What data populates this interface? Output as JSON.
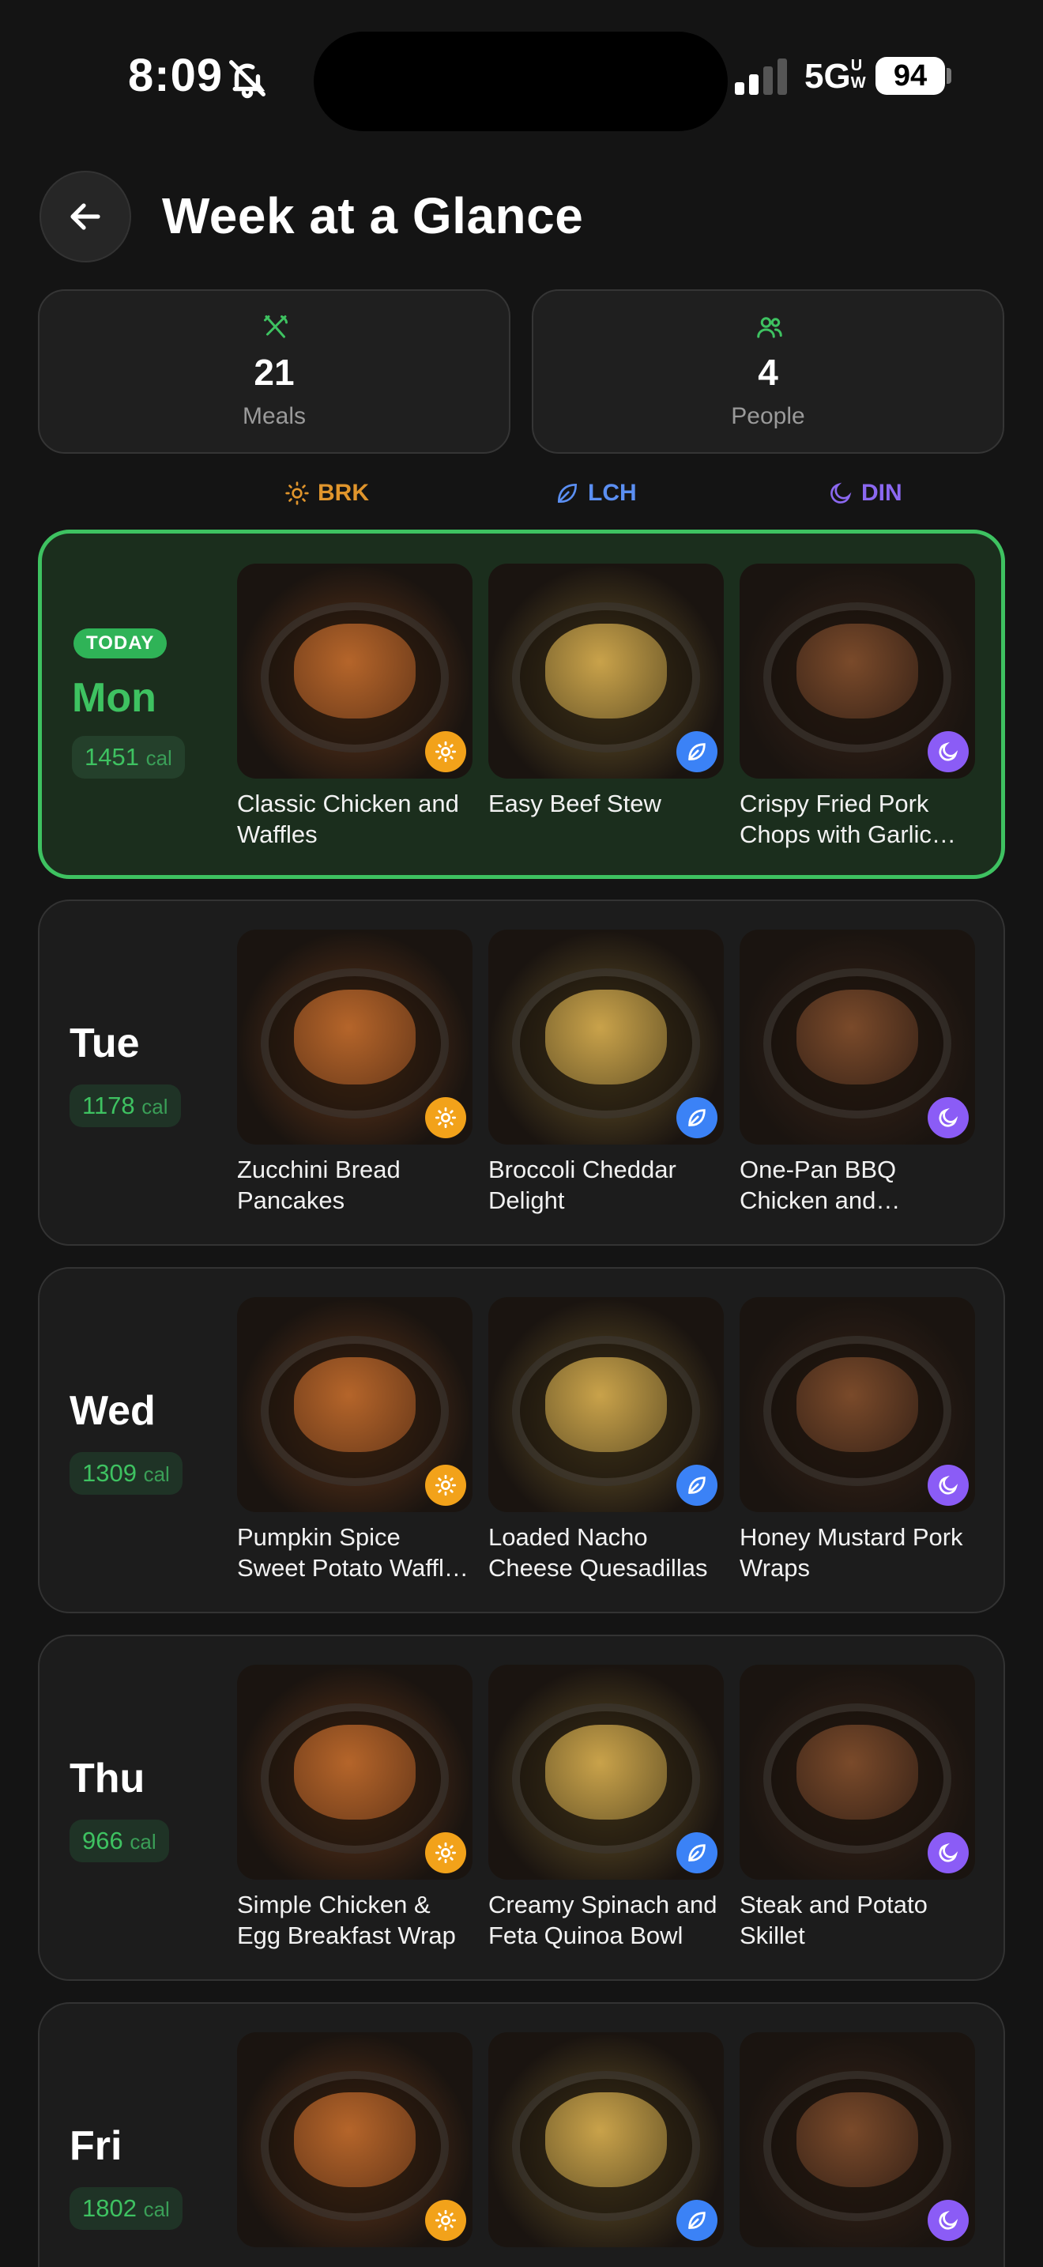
{
  "status_bar": {
    "time": "8:09",
    "network": "5G",
    "network_sup": "UW",
    "battery": "94"
  },
  "header": {
    "title": "Week at a Glance",
    "back_icon": "arrow-left-icon"
  },
  "stats": {
    "meals": {
      "value": "21",
      "label": "Meals",
      "icon": "utensils-icon"
    },
    "people": {
      "value": "4",
      "label": "People",
      "icon": "people-icon"
    }
  },
  "legend": {
    "breakfast": {
      "label": "BRK",
      "icon": "sun-icon",
      "color": "#e0952c"
    },
    "lunch": {
      "label": "LCH",
      "icon": "leaf-icon",
      "color": "#5b8ff2"
    },
    "dinner": {
      "label": "DIN",
      "icon": "moon-icon",
      "color": "#8b68f0"
    }
  },
  "colors": {
    "accent": "#3ec261",
    "brk": "#f2a21a",
    "lch": "#3b82f6",
    "din": "#8b5cf6"
  },
  "days": [
    {
      "name": "Mon",
      "today": true,
      "today_label": "TODAY",
      "calories": "1451",
      "cal_unit": "cal",
      "meals": [
        {
          "title": "Classic Chicken and Waffles",
          "slot": "brk"
        },
        {
          "title": "Easy Beef Stew",
          "slot": "lch"
        },
        {
          "title": "Crispy Fried Pork Chops with Garlic…",
          "slot": "din"
        }
      ]
    },
    {
      "name": "Tue",
      "today": false,
      "calories": "1178",
      "cal_unit": "cal",
      "meals": [
        {
          "title": "Zucchini Bread Pancakes",
          "slot": "brk"
        },
        {
          "title": "Broccoli Cheddar Delight",
          "slot": "lch"
        },
        {
          "title": "One-Pan BBQ Chicken and Sweet…",
          "slot": "din"
        }
      ]
    },
    {
      "name": "Wed",
      "today": false,
      "calories": "1309",
      "cal_unit": "cal",
      "meals": [
        {
          "title": "Pumpkin Spice Sweet Potato Waffl…",
          "slot": "brk"
        },
        {
          "title": "Loaded Nacho Cheese Quesadillas",
          "slot": "lch"
        },
        {
          "title": "Honey Mustard Pork Wraps",
          "slot": "din"
        }
      ]
    },
    {
      "name": "Thu",
      "today": false,
      "calories": "966",
      "cal_unit": "cal",
      "meals": [
        {
          "title": "Simple Chicken & Egg Breakfast Wrap",
          "slot": "brk"
        },
        {
          "title": "Creamy Spinach and Feta Quinoa Bowl",
          "slot": "lch"
        },
        {
          "title": "Steak and Potato Skillet",
          "slot": "din"
        }
      ]
    },
    {
      "name": "Fri",
      "today": false,
      "calories": "1802",
      "cal_unit": "cal",
      "meals": [
        {
          "title": "",
          "slot": "brk"
        },
        {
          "title": "",
          "slot": "lch"
        },
        {
          "title": "",
          "slot": "din"
        }
      ]
    }
  ]
}
